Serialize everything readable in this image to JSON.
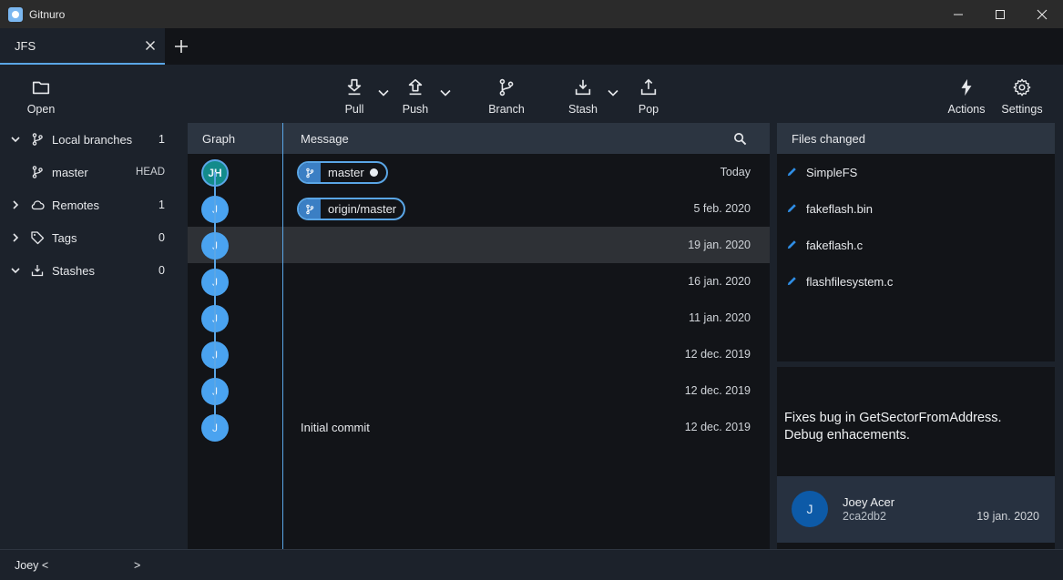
{
  "window": {
    "title": "Gitnuro"
  },
  "tabs": [
    {
      "label": "JFS"
    }
  ],
  "toolbar": {
    "open_label": "Open",
    "pull_label": "Pull",
    "push_label": "Push",
    "branch_label": "Branch",
    "stash_label": "Stash",
    "pop_label": "Pop",
    "actions_label": "Actions",
    "settings_label": "Settings"
  },
  "sidebar": {
    "local_branches": {
      "label": "Local branches",
      "count": "1"
    },
    "branches": [
      {
        "name": "master",
        "badge": "HEAD"
      }
    ],
    "remotes": {
      "label": "Remotes",
      "count": "1"
    },
    "tags": {
      "label": "Tags",
      "count": "0"
    },
    "stashes": {
      "label": "Stashes",
      "count": "0"
    }
  },
  "log": {
    "header_graph": "Graph",
    "header_message": "Message",
    "commits": [
      {
        "avatar": "JH",
        "ref": "master",
        "message": "",
        "date": "Today"
      },
      {
        "avatar": "J",
        "ref": "origin/master",
        "message": "",
        "date": "5 feb. 2020"
      },
      {
        "avatar": "J",
        "message": "",
        "date": "19 jan. 2020",
        "selected": true
      },
      {
        "avatar": "J",
        "message": "",
        "date": "16 jan. 2020"
      },
      {
        "avatar": "J",
        "message": "",
        "date": "11 jan. 2020"
      },
      {
        "avatar": "J",
        "message": "",
        "date": "12 dec. 2019"
      },
      {
        "avatar": "J",
        "message": "",
        "date": "12 dec. 2019"
      },
      {
        "avatar": "J",
        "message": "Initial commit",
        "date": "12 dec. 2019"
      }
    ]
  },
  "files_changed": {
    "header": "Files changed",
    "files": [
      "SimpleFS",
      "fakeflash.bin",
      "fakeflash.c",
      "flashfilesystem.c"
    ]
  },
  "commit_detail": {
    "message_line1": "Fixes bug in GetSectorFromAddress.",
    "message_line2": "Debug enhacements.",
    "author_initial": "J",
    "author_name": "Joey Acer",
    "hash": "2ca2db2",
    "date": "19 jan. 2020"
  },
  "statusbar": {
    "user": "Joey <",
    "suffix": ">"
  },
  "colors": {
    "accent": "#5aa6e6",
    "avatar": "#4aa3f0",
    "background": "#1c222b",
    "panel": "#121418",
    "header": "#2c3541"
  }
}
